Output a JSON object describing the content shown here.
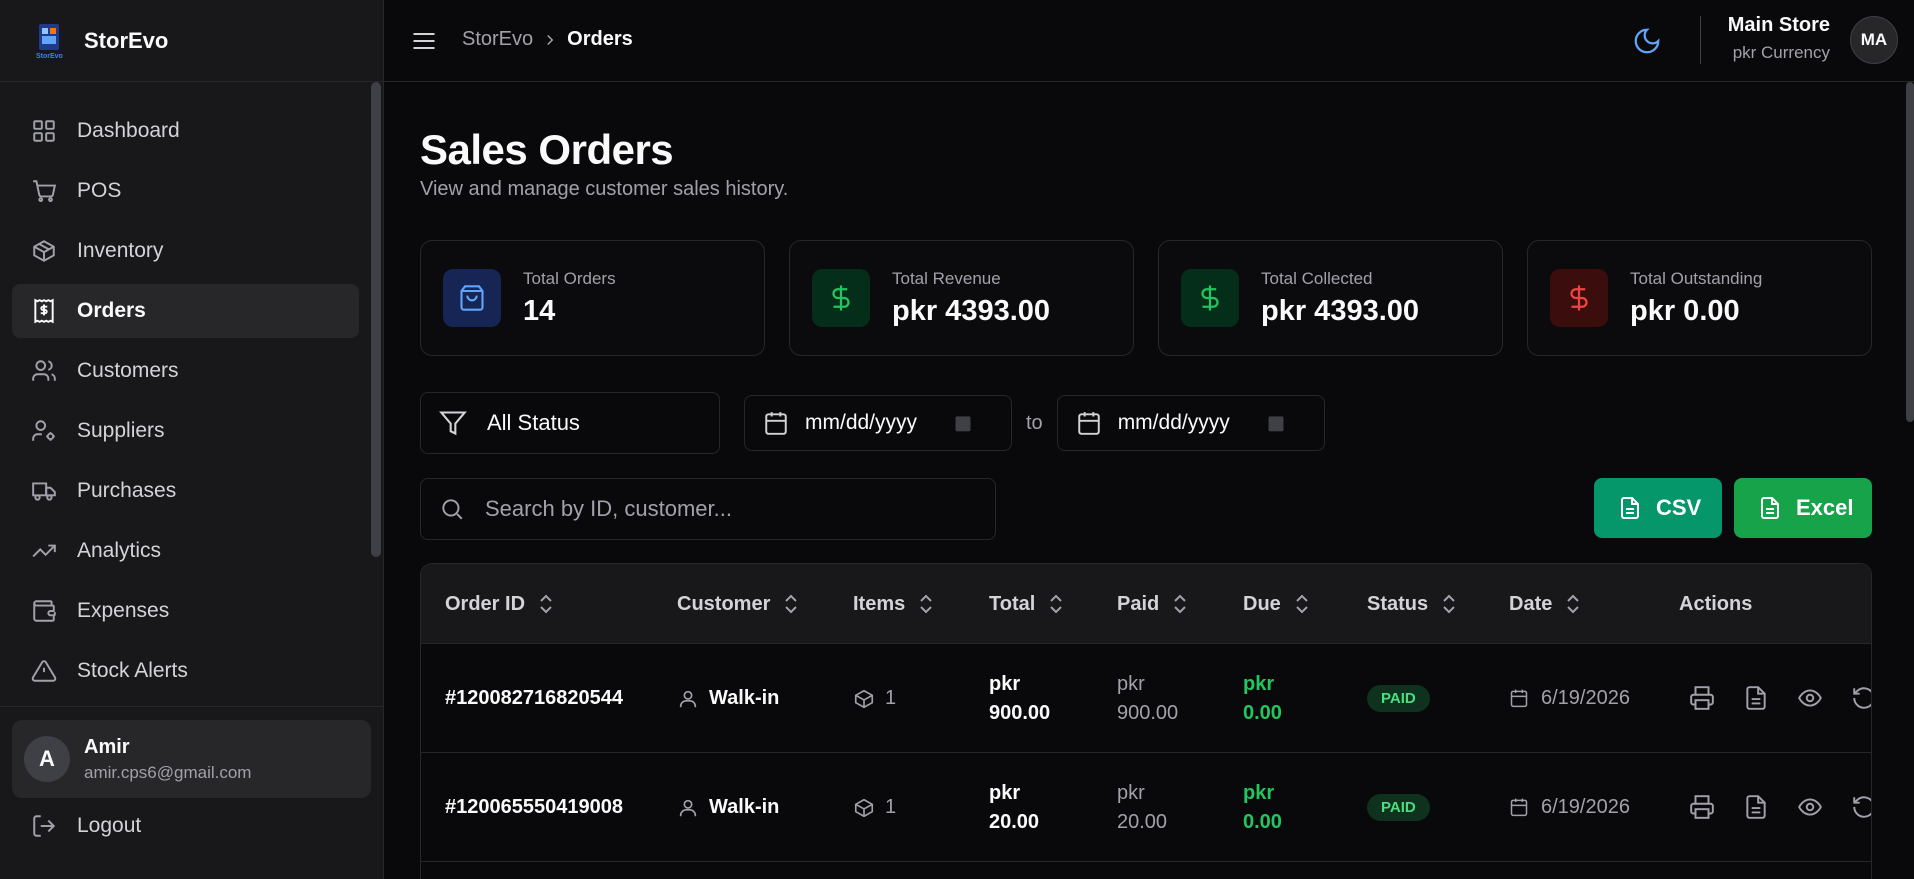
{
  "brand": {
    "name": "StorEvo",
    "logo_text": "StorEvo"
  },
  "sidebar": {
    "items": [
      {
        "label": "Dashboard",
        "icon": "grid-icon"
      },
      {
        "label": "POS",
        "icon": "cart-icon"
      },
      {
        "label": "Inventory",
        "icon": "box-icon"
      },
      {
        "label": "Orders",
        "icon": "receipt-icon",
        "active": true
      },
      {
        "label": "Customers",
        "icon": "users-icon"
      },
      {
        "label": "Suppliers",
        "icon": "user-cog-icon"
      },
      {
        "label": "Purchases",
        "icon": "truck-icon"
      },
      {
        "label": "Analytics",
        "icon": "trending-icon"
      },
      {
        "label": "Expenses",
        "icon": "wallet-icon"
      },
      {
        "label": "Stock Alerts",
        "icon": "alert-icon"
      }
    ],
    "user": {
      "initial": "A",
      "name": "Amir",
      "email": "amir.cps6@gmail.com"
    },
    "logout_label": "Logout"
  },
  "header": {
    "breadcrumb_root": "StorEvo",
    "breadcrumb_current": "Orders",
    "store_name": "Main Store",
    "store_currency": "pkr Currency",
    "avatar_initials": "MA"
  },
  "page": {
    "title": "Sales Orders",
    "subtitle": "View and manage customer sales history."
  },
  "stats": [
    {
      "label": "Total Orders",
      "value": "14",
      "icon": "shopping-bag-icon",
      "color": "#60a5fa",
      "bg": "#172554"
    },
    {
      "label": "Total Revenue",
      "value": "pkr 4393.00",
      "icon": "dollar-icon",
      "color": "#22c55e",
      "bg": "#052e1a"
    },
    {
      "label": "Total Collected",
      "value": "pkr 4393.00",
      "icon": "dollar-icon",
      "color": "#22c55e",
      "bg": "#052e1a"
    },
    {
      "label": "Total Outstanding",
      "value": "pkr 0.00",
      "icon": "dollar-icon",
      "color": "#ef4444",
      "bg": "#3b0d0d"
    }
  ],
  "filters": {
    "status_value": "All Status",
    "date_from_placeholder": "mm/dd/yyyy",
    "date_to_placeholder": "mm/dd/yyyy",
    "to_label": "to"
  },
  "search": {
    "placeholder": "Search by ID, customer..."
  },
  "export": {
    "csv_label": "CSV",
    "excel_label": "Excel"
  },
  "table": {
    "columns": [
      "Order ID",
      "Customer",
      "Items",
      "Total",
      "Paid",
      "Due",
      "Status",
      "Date",
      "Actions"
    ],
    "rows": [
      {
        "order_id": "#120082716820544",
        "customer": "Walk-in",
        "items": "1",
        "total_cur": "pkr",
        "total_amt": "900.00",
        "paid_cur": "pkr",
        "paid_amt": "900.00",
        "due_cur": "pkr",
        "due_amt": "0.00",
        "status": "PAID",
        "date": "6/19/2026"
      },
      {
        "order_id": "#120065550419008",
        "customer": "Walk-in",
        "items": "1",
        "total_cur": "pkr",
        "total_amt": "20.00",
        "paid_cur": "pkr",
        "paid_amt": "20.00",
        "due_cur": "pkr",
        "due_amt": "0.00",
        "status": "PAID",
        "date": "6/19/2026"
      }
    ]
  }
}
